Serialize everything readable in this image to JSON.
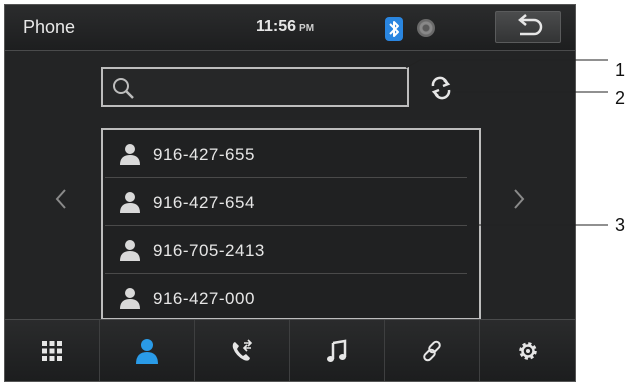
{
  "header": {
    "title": "Phone",
    "time": "11:56",
    "ampm": "PM"
  },
  "search": {
    "placeholder": "",
    "value": ""
  },
  "contacts": [
    {
      "number": "916-427-655"
    },
    {
      "number": "916-427-654"
    },
    {
      "number": "916-705-2413"
    },
    {
      "number": "916-427-000"
    }
  ],
  "navigation": [
    {
      "name": "keypad",
      "icon": "grid-icon"
    },
    {
      "name": "contacts",
      "icon": "person-icon",
      "active": true
    },
    {
      "name": "call-log",
      "icon": "phone-transfer-icon"
    },
    {
      "name": "music",
      "icon": "music-note-icon"
    },
    {
      "name": "link",
      "icon": "link-icon"
    },
    {
      "name": "settings",
      "icon": "gear-icon"
    }
  ],
  "colors": {
    "accent": "#2a86e0",
    "background": "#232425",
    "border": "#bdbdbd"
  },
  "callouts": {
    "c1": "1",
    "c2": "2",
    "c3": "3"
  }
}
